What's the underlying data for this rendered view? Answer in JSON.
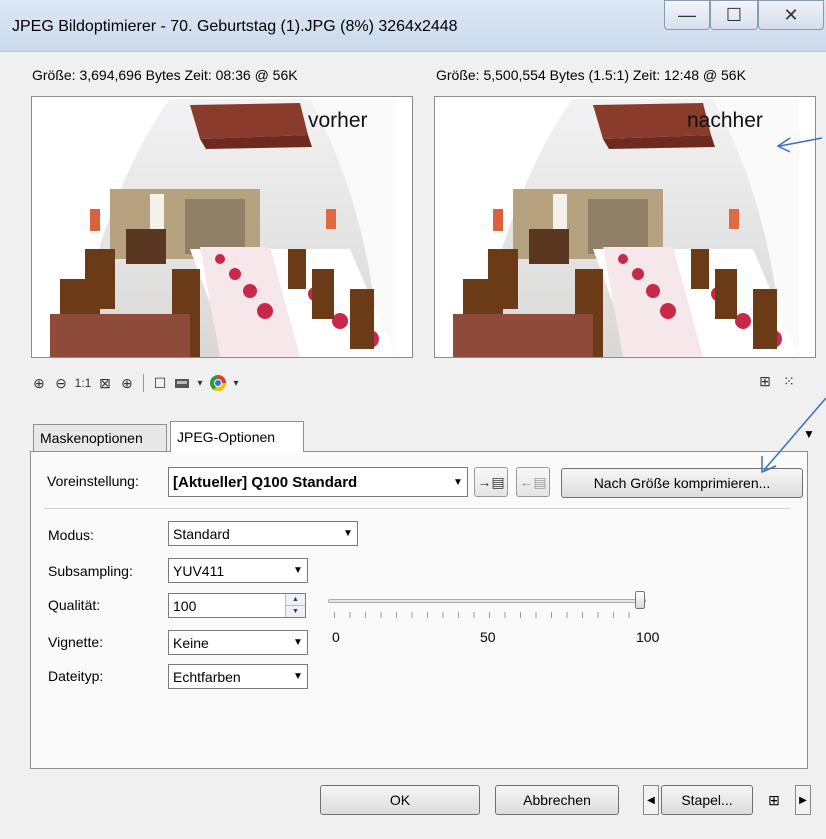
{
  "window": {
    "title": "JPEG Bildoptimierer - 70. Geburtstag  (1).JPG (8%) 3264x2448",
    "min_glyph": "—",
    "max_glyph": "☐",
    "close_glyph": "✕"
  },
  "preview_before": {
    "info": "Größe: 3,694,696 Bytes Zeit: 08:36 @ 56K",
    "overlay": "vorher"
  },
  "preview_after": {
    "info": "Größe: 5,500,554 Bytes (1.5:1) Zeit: 12:48 @ 56K",
    "overlay": "nachher"
  },
  "toolbar": {
    "zoom_in": "⊕",
    "zoom_out": "⊖",
    "one_to_one": "1:1",
    "fit": "⊠",
    "pan": "⊕",
    "single_view": "☐",
    "dropdown": "▾",
    "right_a": "⊞",
    "right_b": "⁙"
  },
  "tabs": [
    {
      "label": "Maskenoptionen"
    },
    {
      "label": "JPEG-Optionen"
    }
  ],
  "tab_menu_arrow": "▼",
  "preset": {
    "label": "Voreinstellung:",
    "value": "[Aktueller] Q100 Standard",
    "compress_button": "Nach Größe komprimieren..."
  },
  "fields": {
    "mode_label": "Modus:",
    "mode_value": "Standard",
    "subsampling_label": "Subsampling:",
    "subsampling_value": "YUV411",
    "quality_label": "Qualität:",
    "quality_value": "100",
    "vignette_label": "Vignette:",
    "vignette_value": "Keine",
    "filetype_label": "Dateityp:",
    "filetype_value": "Echtfarben"
  },
  "slider": {
    "min_label": "0",
    "mid_label": "50",
    "max_label": "100",
    "min": 0,
    "max": 100,
    "value": 100
  },
  "buttons": {
    "ok": "OK",
    "cancel": "Abbrechen",
    "batch": "Stapel...",
    "prev": "◀",
    "next": "▶",
    "help": "⊞"
  },
  "colors": {
    "annotation_arrow": "#3a6fbf"
  }
}
